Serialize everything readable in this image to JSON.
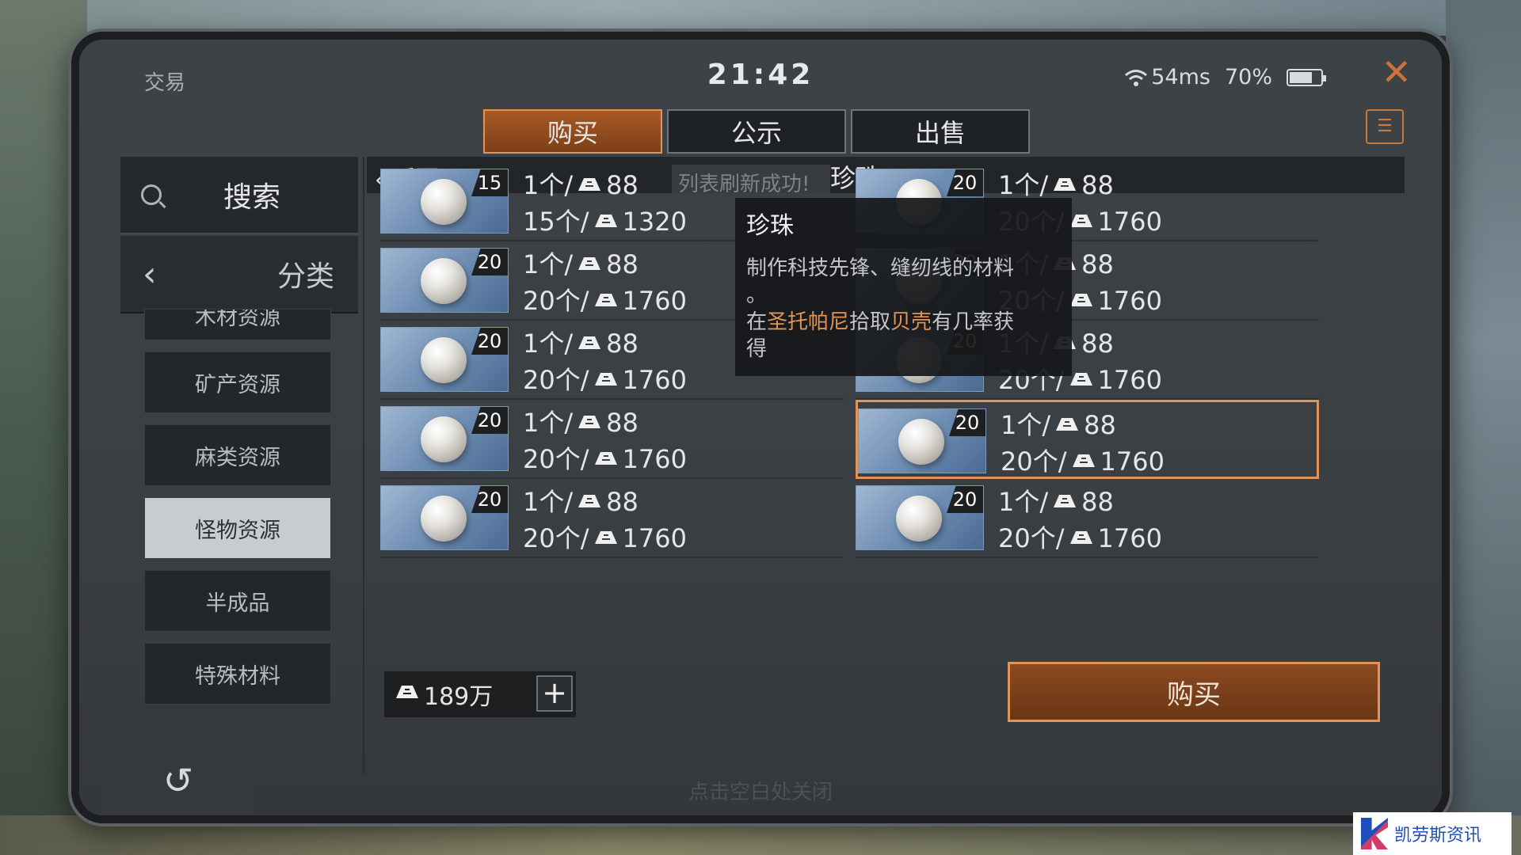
{
  "status_bar": {
    "app_title": "交易",
    "clock": "21:42",
    "ping": "54ms",
    "battery": "70%",
    "battery_level": 0.7
  },
  "tabs": [
    {
      "label": "购买",
      "active": true
    },
    {
      "label": "公示",
      "active": false
    },
    {
      "label": "出售",
      "active": false
    }
  ],
  "sidebar": {
    "search_label": "搜索",
    "category_label": "分类",
    "items": [
      {
        "label": "木材资源"
      },
      {
        "label": "矿产资源"
      },
      {
        "label": "麻类资源"
      },
      {
        "label": "怪物资源",
        "active": true
      },
      {
        "label": "半成品"
      },
      {
        "label": "特殊材料"
      }
    ]
  },
  "list": {
    "back_label": "返回",
    "toast": "列表刷新成功!",
    "title": "珍珠",
    "items": [
      {
        "qty": "15",
        "unit": "1个/",
        "unit_price": "88",
        "bulk": "15个/",
        "bulk_price": "1320"
      },
      {
        "qty": "20",
        "unit": "1个/",
        "unit_price": "88",
        "bulk": "20个/",
        "bulk_price": "1760"
      },
      {
        "qty": "20",
        "unit": "1个/",
        "unit_price": "88",
        "bulk": "20个/",
        "bulk_price": "1760"
      },
      {
        "qty": "20",
        "unit": "1个/",
        "unit_price": "88",
        "bulk": "20个/",
        "bulk_price": "1760"
      },
      {
        "qty": "20",
        "unit": "1个/",
        "unit_price": "88",
        "bulk": "20个/",
        "bulk_price": "1760"
      },
      {
        "qty": "20",
        "unit": "1个/",
        "unit_price": "88",
        "bulk": "20个/",
        "bulk_price": "1760"
      },
      {
        "qty": "20",
        "unit": "1个/",
        "unit_price": "88",
        "bulk": "20个/",
        "bulk_price": "1760"
      },
      {
        "qty": "20",
        "unit": "1个/",
        "unit_price": "88",
        "bulk": "20个/",
        "bulk_price": "1760"
      },
      {
        "qty": "20",
        "unit": "1个/",
        "unit_price": "88",
        "bulk": "20个/",
        "bulk_price": "1760"
      },
      {
        "qty": "20",
        "unit": "1个/",
        "unit_price": "88",
        "bulk": "20个/",
        "bulk_price": "1760"
      }
    ]
  },
  "tooltip": {
    "title": "珍珠",
    "line1": "制作科技先锋、缝纫线的材料",
    "line2": "。",
    "prefix": "在",
    "place": "圣托帕尼",
    "mid": "拾取",
    "source": "贝壳",
    "suffix": "有几率获",
    "tail": "得"
  },
  "footer": {
    "balance": "189万",
    "plus": "+",
    "buy_label": "购买",
    "undo": "↺",
    "hint": "点击空白处关闭"
  },
  "watermark": {
    "text": "凯劳斯资讯"
  },
  "colors": {
    "accent": "#e0945a",
    "highlight": "#e09458"
  }
}
